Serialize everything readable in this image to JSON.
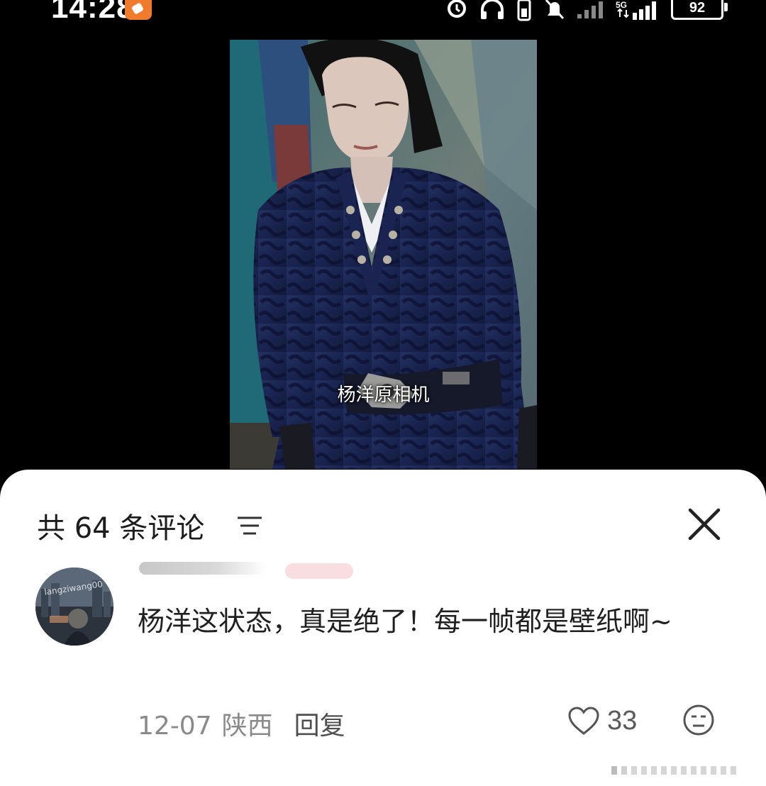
{
  "status_bar": {
    "time": "14:28",
    "battery": "92",
    "icons": [
      "alarm-icon",
      "headphones-icon",
      "vibrate-icon",
      "mute-icon",
      "signal-icon",
      "5g-signal-icon"
    ]
  },
  "video": {
    "caption": "杨洋原相机"
  },
  "comments_sheet": {
    "title": "共 64 条评论",
    "comments": [
      {
        "avatar_text": "langziwang00",
        "text": "杨洋这状态，真是绝了！每一帧都是壁纸啊~",
        "date": "12-07",
        "location": "陕西",
        "reply_label": "回复",
        "likes": "33"
      }
    ]
  },
  "colors": {
    "sheet_bg": "#ffffff",
    "meta_gray": "#8a8a8a",
    "badge_pink": "#f6d4d9",
    "app_badge_orange": "#f07b2c"
  }
}
